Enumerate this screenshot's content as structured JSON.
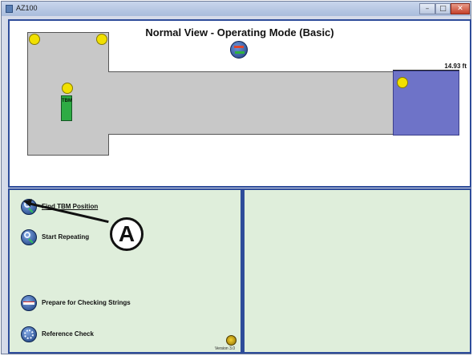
{
  "window": {
    "title": "AZ100",
    "controls": {
      "minimize": "–",
      "maximize": "□",
      "close": "✕"
    }
  },
  "view": {
    "title": "Normal View - Operating Mode (Basic)",
    "measurement": "14.93 ft",
    "tbm_label": "TBM",
    "mode_icon": "swap-arrows-icon"
  },
  "menu": {
    "find_tbm": "Find TBM Position",
    "start_repeating": "Start Repeating",
    "prepare_strings": "Prepare for Checking Strings",
    "reference_check": "Reference Check"
  },
  "callout": {
    "label": "A"
  },
  "footer": {
    "version": "Version 3.0"
  },
  "colors": {
    "panel_border": "#2e4c9a",
    "panel_green": "#dfeedb",
    "floor_gray": "#c8c8c8",
    "zone_blue": "#6e73c8",
    "marker_yellow": "#f1e000",
    "tbm_green": "#2eab44"
  }
}
